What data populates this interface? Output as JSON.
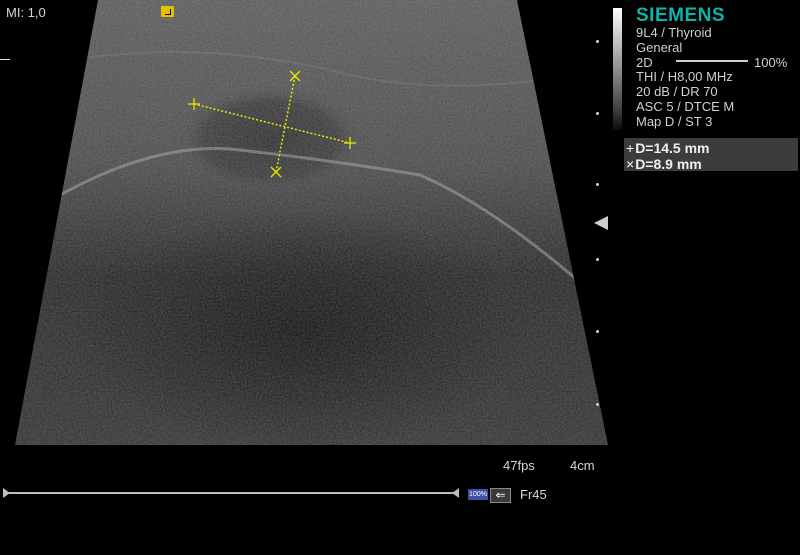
{
  "top": {
    "mi_label": "MI:  1,0"
  },
  "brand": {
    "name": "SIEMENS"
  },
  "info": {
    "transducer": "9L4 / Thyroid",
    "preset": "General",
    "mode": "2D",
    "gain_percent": "100%",
    "line1": "THI / H8,00 MHz",
    "line2": "20 dB / DR 70",
    "line3": "ASC 5 / DTCE M",
    "line4": "Map D / ST 3"
  },
  "measurements": [
    {
      "symbol": "+",
      "text": "D=14.5 mm",
      "value_mm": 14.5
    },
    {
      "symbol": "×",
      "text": "D=8.9 mm",
      "value_mm": 8.9
    }
  ],
  "status": {
    "fps": "47fps",
    "depth": "4cm"
  },
  "cine": {
    "speed_badge": "100%",
    "back_symbol": "⇐",
    "frame": "Fr45"
  },
  "colors": {
    "brand": "#0db3a9",
    "caliper": "#e6e600",
    "marker": "#e2c200",
    "speed_badge": "#3f4fa6"
  },
  "icons": [
    "orientation-marker-icon",
    "grayscale-bar",
    "focus-marker-icon",
    "caliper-plus-icon",
    "caliper-x-icon",
    "back-arrow-icon"
  ]
}
